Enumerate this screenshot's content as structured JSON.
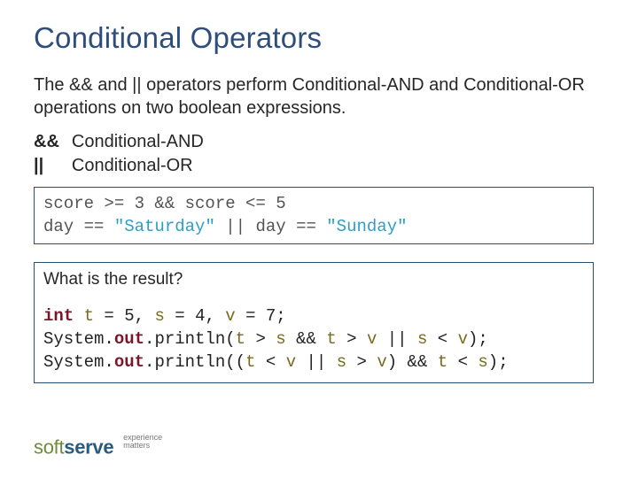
{
  "title": "Conditional Operators",
  "intro": "The && and || operators perform Conditional-AND and Conditional-OR operations on two boolean expressions.",
  "operators": [
    {
      "sym": "&&",
      "desc": "Conditional-AND"
    },
    {
      "sym": "||",
      "desc": "Conditional-OR"
    }
  ],
  "code1": {
    "line1_pre": "score >= 3 && score <= 5",
    "line2_a": "day == ",
    "line2_s1": "\"Saturday\"",
    "line2_b": " || day == ",
    "line2_s2": "\"Sunday\""
  },
  "question": "What is the result?",
  "code2": {
    "decl_kw": "int",
    "decl_rest_a": " ",
    "decl_t": "t",
    "decl_rest_b": " = 5, ",
    "decl_s": "s",
    "decl_rest_c": " = 4, ",
    "decl_v": "v",
    "decl_rest_d": " = 7;",
    "l1_a": "System.",
    "l1_out": "out",
    "l1_b": ".println(",
    "l1_t1": "t",
    "l1_c": " > ",
    "l1_s1": "s",
    "l1_d": " && ",
    "l1_t2": "t",
    "l1_e": " > ",
    "l1_v1": "v",
    "l1_f": " || ",
    "l1_s2": "s",
    "l1_g": " < ",
    "l1_v2": "v",
    "l1_h": ");",
    "l2_a": "System.",
    "l2_out": "out",
    "l2_b": ".println((",
    "l2_t1": "t",
    "l2_c": " < ",
    "l2_v1": "v",
    "l2_d": " || ",
    "l2_s1": "s",
    "l2_e": " > ",
    "l2_v2": "v",
    "l2_f": ") && ",
    "l2_t2": "t",
    "l2_g": " < ",
    "l2_s2": "s",
    "l2_h": ");"
  },
  "logo": {
    "soft": "soft",
    "serve": "serve",
    "tag1": "experience",
    "tag2": "matters"
  }
}
